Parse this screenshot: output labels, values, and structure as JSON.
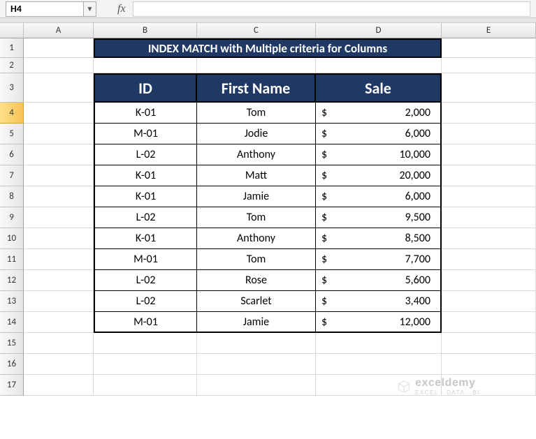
{
  "namebox": {
    "ref": "H4"
  },
  "fx_label": "fx",
  "columns": [
    "",
    "A",
    "B",
    "C",
    "D",
    "E"
  ],
  "rows": [
    "1",
    "2",
    "3",
    "4",
    "5",
    "6",
    "7",
    "8",
    "9",
    "10",
    "11",
    "12",
    "13",
    "14",
    "15",
    "16",
    "17"
  ],
  "title": "INDEX MATCH with Multiple criteria for Columns",
  "headers": {
    "id": "ID",
    "first_name": "First Name",
    "sale": "Sale"
  },
  "currency": "$",
  "data": [
    {
      "id": "K-01",
      "name": "Tom",
      "sale": "2,000"
    },
    {
      "id": "M-01",
      "name": "Jodie",
      "sale": "6,000"
    },
    {
      "id": "L-02",
      "name": "Anthony",
      "sale": "10,000"
    },
    {
      "id": "K-01",
      "name": "Matt",
      "sale": "20,000"
    },
    {
      "id": "K-01",
      "name": "Jamie",
      "sale": "6,000"
    },
    {
      "id": "L-02",
      "name": "Tom",
      "sale": "9,500"
    },
    {
      "id": "K-01",
      "name": "Anthony",
      "sale": "8,500"
    },
    {
      "id": "M-01",
      "name": "Tom",
      "sale": "7,700"
    },
    {
      "id": "L-02",
      "name": "Rose",
      "sale": "5,600"
    },
    {
      "id": "L-02",
      "name": "Scarlet",
      "sale": "3,400"
    },
    {
      "id": "M-01",
      "name": "Jamie",
      "sale": "12,000"
    }
  ],
  "watermark": {
    "main": "exceldemy",
    "sub": "EXCEL · DATA · BI"
  },
  "chart_data": {
    "type": "table",
    "title": "INDEX MATCH with Multiple criteria for Columns",
    "columns": [
      "ID",
      "First Name",
      "Sale"
    ],
    "rows": [
      [
        "K-01",
        "Tom",
        2000
      ],
      [
        "M-01",
        "Jodie",
        6000
      ],
      [
        "L-02",
        "Anthony",
        10000
      ],
      [
        "K-01",
        "Matt",
        20000
      ],
      [
        "K-01",
        "Jamie",
        6000
      ],
      [
        "L-02",
        "Tom",
        9500
      ],
      [
        "K-01",
        "Anthony",
        8500
      ],
      [
        "M-01",
        "Tom",
        7700
      ],
      [
        "L-02",
        "Rose",
        5600
      ],
      [
        "L-02",
        "Scarlet",
        3400
      ],
      [
        "M-01",
        "Jamie",
        12000
      ]
    ]
  }
}
